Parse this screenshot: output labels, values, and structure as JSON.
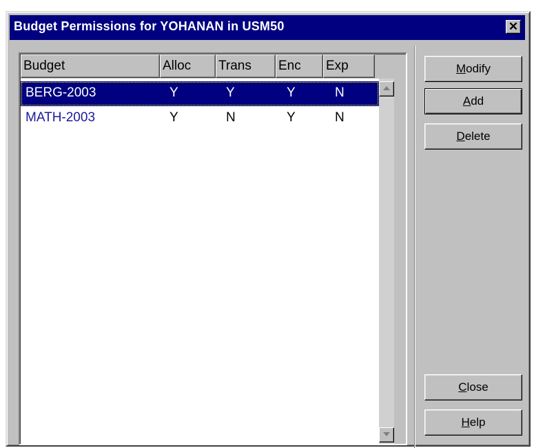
{
  "window": {
    "title": "Budget Permissions for YOHANAN in USM50",
    "close_glyph": "✕"
  },
  "columns": [
    {
      "label": "Budget"
    },
    {
      "label": "Alloc"
    },
    {
      "label": "Trans"
    },
    {
      "label": "Enc"
    },
    {
      "label": "Exp"
    }
  ],
  "rows": [
    {
      "budget": "BERG-2003",
      "alloc": "Y",
      "trans": "Y",
      "enc": "Y",
      "exp": "N",
      "selected": true
    },
    {
      "budget": "MATH-2003",
      "alloc": "Y",
      "trans": "N",
      "enc": "Y",
      "exp": "N",
      "selected": false
    }
  ],
  "buttons": {
    "modify": {
      "mnemonic": "M",
      "rest": "odify"
    },
    "add": {
      "mnemonic": "A",
      "rest": "dd"
    },
    "delete": {
      "mnemonic": "D",
      "rest": "elete"
    },
    "close": {
      "mnemonic": "C",
      "rest": "lose"
    },
    "help": {
      "mnemonic": "H",
      "rest": "elp"
    }
  },
  "colors": {
    "titlebar": "#000080",
    "selection": "#000080",
    "budget_text": "#1a1a9c",
    "face": "#c0c0c0"
  },
  "icons": {
    "scroll_up": "triangle-up-icon",
    "scroll_down": "triangle-down-icon",
    "close": "close-icon"
  }
}
